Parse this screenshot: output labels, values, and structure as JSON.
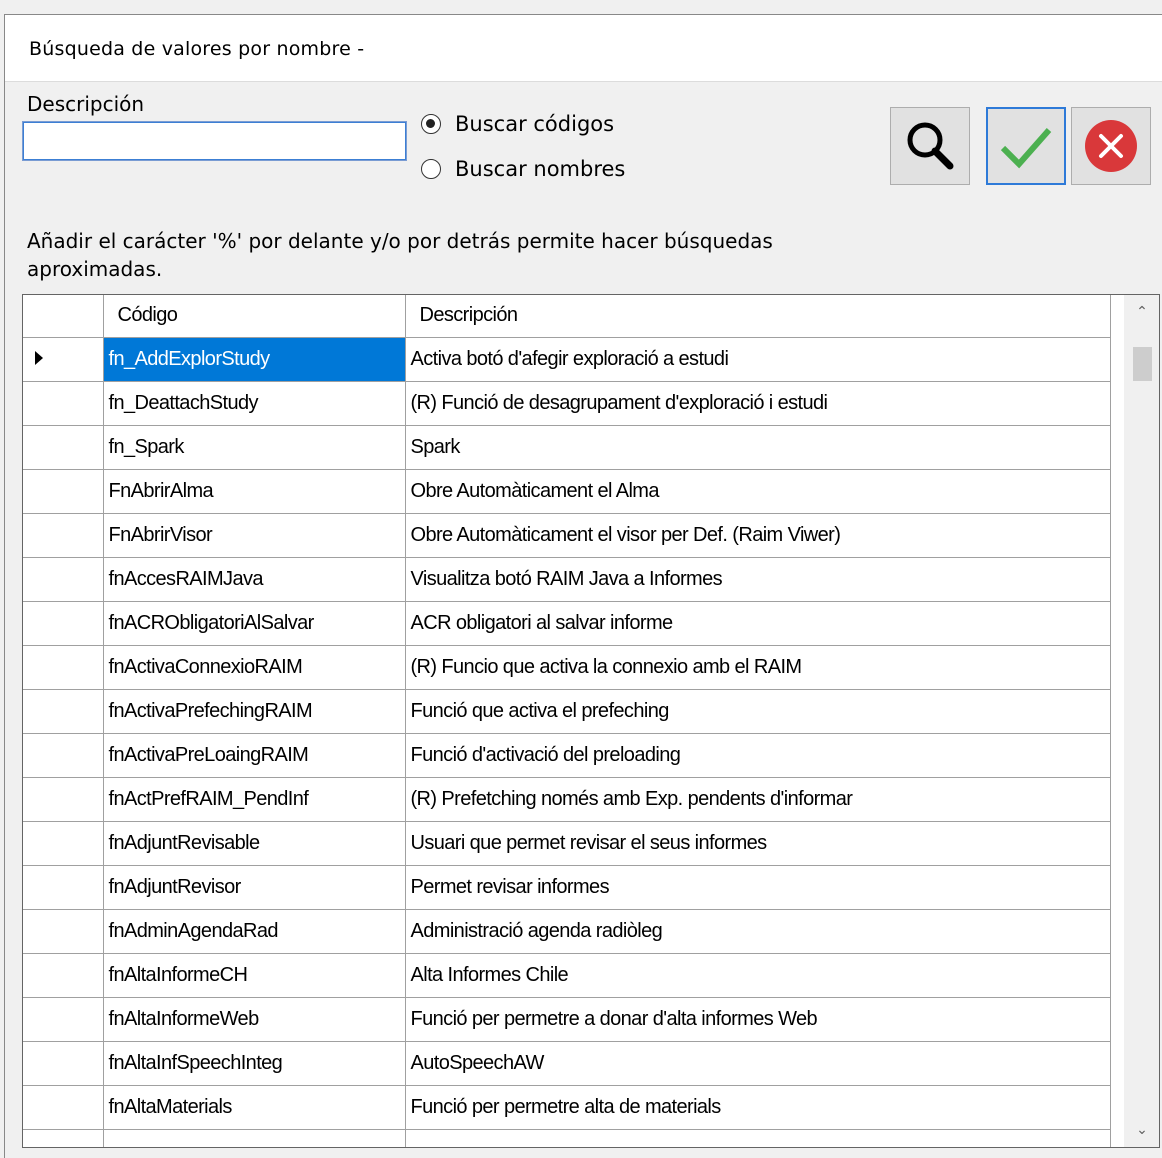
{
  "window": {
    "title": "Búsqueda de valores por nombre -"
  },
  "search": {
    "label": "Descripción",
    "value": "",
    "options": [
      {
        "label": "Buscar códigos",
        "selected": true
      },
      {
        "label": "Buscar nombres",
        "selected": false
      }
    ],
    "hint": "Añadir el carácter '%' por delante y/o por detrás permite hacer búsquedas aproximadas."
  },
  "toolbar": {
    "search_icon": "magnifier-icon",
    "accept_icon": "checkmark-icon",
    "cancel_icon": "cancel-icon",
    "accent_color": "#2e7ad8",
    "check_color": "#4cb050",
    "cancel_color": "#d9383a"
  },
  "grid": {
    "columns": [
      "Código",
      "Descripción"
    ],
    "selected_color": "#0078d7",
    "rows": [
      {
        "code": "fn_AddExplorStudy",
        "desc": "Activa botó d'afegir exploració a estudi"
      },
      {
        "code": "fn_DeattachStudy",
        "desc": "(R) Funció de desagrupament d'exploració i estudi"
      },
      {
        "code": "fn_Spark",
        "desc": "Spark"
      },
      {
        "code": "FnAbrirAlma",
        "desc": "Obre Automàticament el Alma"
      },
      {
        "code": "FnAbrirVisor",
        "desc": "Obre Automàticament el visor per Def. (Raim Viwer)"
      },
      {
        "code": "fnAccesRAIMJava",
        "desc": "Visualitza botó RAIM Java a Informes"
      },
      {
        "code": "fnACRObligatoriAlSalvar",
        "desc": "ACR obligatori al salvar informe"
      },
      {
        "code": "fnActivaConnexioRAIM",
        "desc": "(R) Funcio que activa la connexio amb el RAIM"
      },
      {
        "code": "fnActivaPrefechingRAIM",
        "desc": "Funció que activa el prefeching"
      },
      {
        "code": "fnActivaPreLoaingRAIM",
        "desc": "Funció d'activació del preloading"
      },
      {
        "code": "fnActPrefRAIM_PendInf",
        "desc": "(R) Prefetching només amb Exp. pendents d'informar"
      },
      {
        "code": "fnAdjuntRevisable",
        "desc": "Usuari que permet revisar el seus informes"
      },
      {
        "code": "fnAdjuntRevisor",
        "desc": "Permet revisar informes"
      },
      {
        "code": "fnAdminAgendaRad",
        "desc": "Administració agenda radiòleg"
      },
      {
        "code": "fnAltaInformeCH",
        "desc": "Alta Informes Chile"
      },
      {
        "code": "fnAltaInformeWeb",
        "desc": "Funció per permetre a donar d'alta informes  Web"
      },
      {
        "code": "fnAltaInfSpeechInteg",
        "desc": "AutoSpeechAW"
      },
      {
        "code": "fnAltaMaterials",
        "desc": "Funció per permetre alta de materials"
      },
      {
        "code": "",
        "desc": ""
      }
    ]
  }
}
